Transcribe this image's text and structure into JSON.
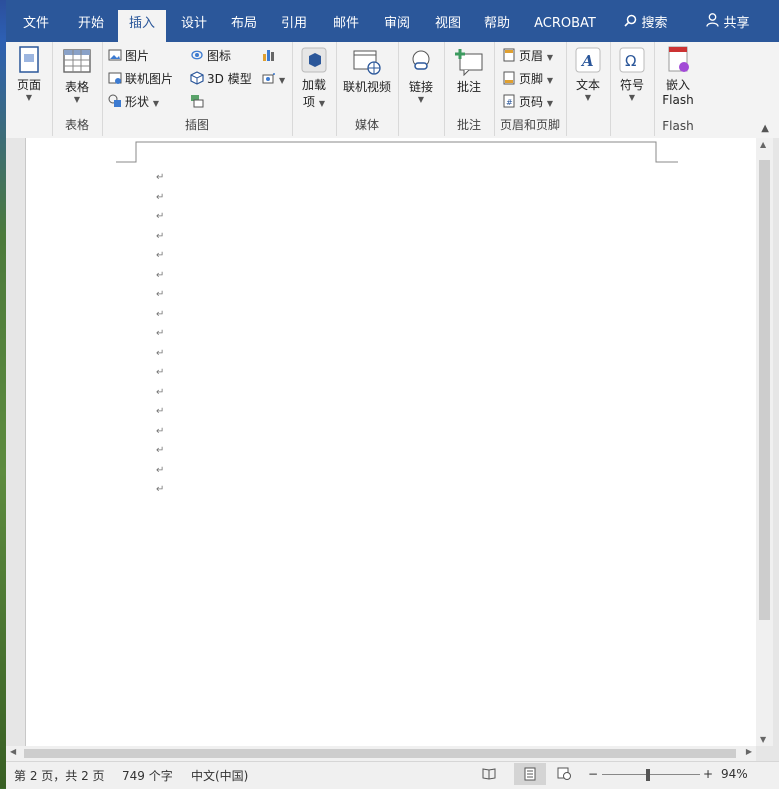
{
  "ribbon_tabs": [
    "文件",
    "开始",
    "插入",
    "设计",
    "布局",
    "引用",
    "邮件",
    "审阅",
    "视图",
    "帮助",
    "ACROBAT"
  ],
  "active_tab": "插入",
  "search_label": "搜索",
  "share_label": "共享",
  "groups": {
    "page": {
      "button": "页面"
    },
    "table": {
      "button": "表格",
      "label": "表格"
    },
    "illustrations": {
      "label": "插图",
      "pictures": "图片",
      "online_pictures": "联机图片",
      "shapes": "形状",
      "icons": "图标",
      "models_3d": "3D 模型"
    },
    "addins": {
      "line1": "加载",
      "line2": "项"
    },
    "media": {
      "button": "联机视频",
      "label": "媒体"
    },
    "links": {
      "button": "链接"
    },
    "comments": {
      "button": "批注",
      "label": "批注"
    },
    "header_footer": {
      "header": "页眉",
      "footer": "页脚",
      "page_number": "页码",
      "label": "页眉和页脚"
    },
    "text": {
      "button": "文本"
    },
    "symbols": {
      "button": "符号"
    },
    "flash": {
      "line1": "嵌入",
      "line2": "Flash",
      "label": "Flash"
    }
  },
  "paragraph_mark": "↵",
  "paragraph_count": 17,
  "status": {
    "page_info": "第 2 页，共 2 页",
    "word_count": "749 个字",
    "language": "中文(中国)",
    "zoom": "94%"
  },
  "colors": {
    "ribbon_tab_bg": "#2b579a",
    "ribbon_bg": "#f3f3f3",
    "doc_bg": "#ffffff"
  }
}
